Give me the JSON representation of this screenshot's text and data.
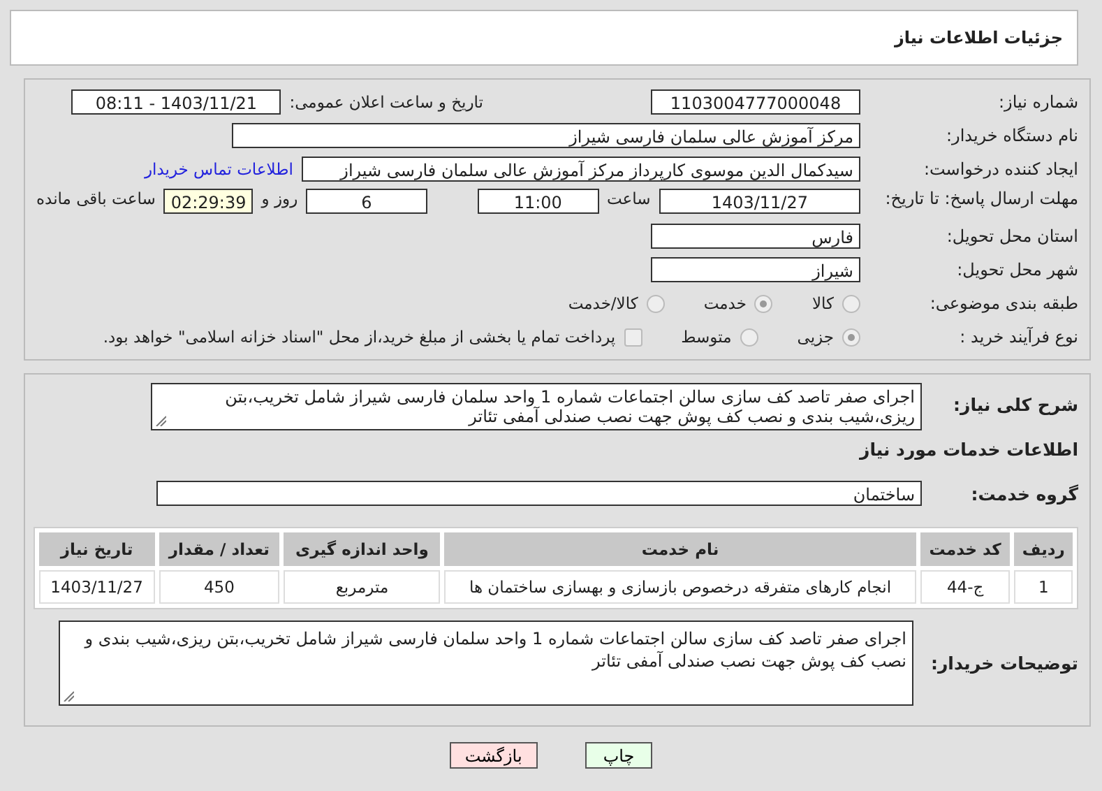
{
  "header": {
    "title": "جزئیات اطلاعات نیاز"
  },
  "need_number": {
    "label": "شماره نیاز:",
    "value": "1103004777000048"
  },
  "announce": {
    "label": "تاریخ و ساعت اعلان عمومی:",
    "value": "1403/11/21 - 08:11"
  },
  "buyer_org": {
    "label": "نام دستگاه خریدار:",
    "value": "مرکز آموزش عالی سلمان فارسی شیراز"
  },
  "requester": {
    "label": "ایجاد کننده درخواست:",
    "value": "سیدکمال الدین موسوی کارپرداز مرکز آموزش عالی سلمان فارسی شیراز",
    "link": "اطلاعات تماس خریدار"
  },
  "deadline": {
    "label": "مهلت ارسال پاسخ: تا تاریخ:",
    "date": "1403/11/27",
    "time_label": "ساعت",
    "time": "11:00",
    "days": "6",
    "days_label": "روز و",
    "remaining": "02:29:39",
    "remaining_label": "ساعت باقی مانده"
  },
  "province": {
    "label": "استان محل تحویل:",
    "value": "فارس"
  },
  "city": {
    "label": "شهر محل تحویل:",
    "value": "شیراز"
  },
  "category": {
    "label": "طبقه بندی موضوعی:",
    "options": [
      {
        "label": "کالا",
        "selected": false
      },
      {
        "label": "خدمت",
        "selected": true
      },
      {
        "label": "کالا/خدمت",
        "selected": false
      }
    ]
  },
  "process": {
    "label": "نوع فرآیند خرید :",
    "options": [
      {
        "label": "جزیی",
        "selected": true
      },
      {
        "label": "متوسط",
        "selected": false
      }
    ],
    "payment": {
      "label": "پرداخت تمام یا بخشی از مبلغ خرید،از محل \"اسناد خزانه اسلامی\" خواهد بود.",
      "checked": false
    }
  },
  "description": {
    "label": "شرح کلی نیاز:",
    "value": "اجرای صفر تاصد کف سازی سالن اجتماعات شماره 1 واحد سلمان فارسی شیراز شامل تخریب،بتن ریزی،شیب بندی و نصب کف پوش جهت نصب صندلی آمفی تئاتر"
  },
  "services_title": "اطلاعات خدمات مورد نیاز",
  "service_group": {
    "label": "گروه خدمت:",
    "value": "ساختمان"
  },
  "table": {
    "columns": [
      "ردیف",
      "کد خدمت",
      "نام خدمت",
      "واحد اندازه گیری",
      "تعداد / مقدار",
      "تاریخ نیاز"
    ],
    "rows": [
      [
        "1",
        "ج-44",
        "انجام کارهای متفرقه درخصوص بازسازی و بهسازی ساختمان ها",
        "مترمربع",
        "450",
        "1403/11/27"
      ]
    ]
  },
  "buyer_notes": {
    "label": "توضیحات خریدار:",
    "value": "اجرای صفر تاصد کف سازی سالن اجتماعات شماره 1 واحد سلمان فارسی شیراز شامل تخریب،بتن ریزی،شیب بندی و نصب کف پوش جهت نصب صندلی آمفی تئاتر"
  },
  "buttons": [
    {
      "label": "چاپ",
      "kind": "print"
    },
    {
      "label": "بازگشت",
      "kind": "back"
    }
  ]
}
